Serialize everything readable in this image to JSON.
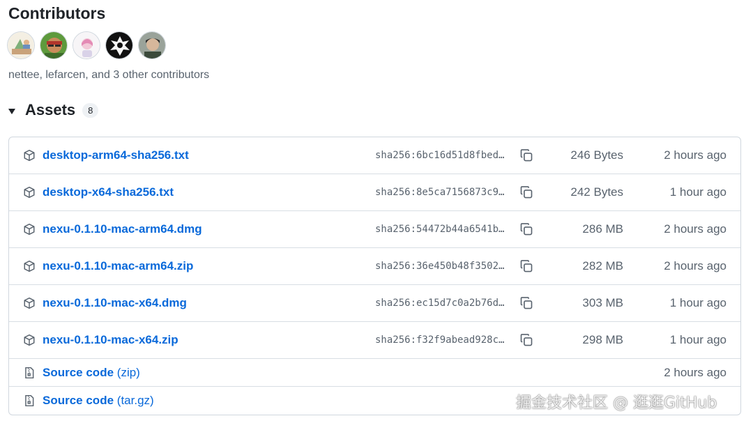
{
  "contributors": {
    "title": "Contributors",
    "avatars": [
      "nettee",
      "lefarcen",
      "contributor-3",
      "contributor-4",
      "contributor-5"
    ],
    "summary": "nettee, lefarcen, and 3 other contributors"
  },
  "assets": {
    "title": "Assets",
    "count": "8",
    "files": [
      {
        "name": "desktop-arm64-sha256.txt",
        "sha": "sha256:6bc16d51d8fbed…",
        "size": "246 Bytes",
        "time": "2 hours ago"
      },
      {
        "name": "desktop-x64-sha256.txt",
        "sha": "sha256:8e5ca7156873c9…",
        "size": "242 Bytes",
        "time": "1 hour ago"
      },
      {
        "name": "nexu-0.1.10-mac-arm64.dmg",
        "sha": "sha256:54472b44a6541b…",
        "size": "286 MB",
        "time": "2 hours ago"
      },
      {
        "name": "nexu-0.1.10-mac-arm64.zip",
        "sha": "sha256:36e450b48f3502…",
        "size": "282 MB",
        "time": "2 hours ago"
      },
      {
        "name": "nexu-0.1.10-mac-x64.dmg",
        "sha": "sha256:ec15d7c0a2b76d…",
        "size": "303 MB",
        "time": "1 hour ago"
      },
      {
        "name": "nexu-0.1.10-mac-x64.zip",
        "sha": "sha256:f32f9abead928c…",
        "size": "298 MB",
        "time": "1 hour ago"
      }
    ],
    "source": [
      {
        "label": "Source code",
        "suffix": "(zip)",
        "time": "2 hours ago"
      },
      {
        "label": "Source code",
        "suffix": "(tar.gz)",
        "time": ""
      }
    ]
  },
  "watermark": "掘金技术社区 @ 逛逛GitHub",
  "colors": {
    "link": "#0969da",
    "muted": "#59636e",
    "border": "#d0d7de"
  }
}
